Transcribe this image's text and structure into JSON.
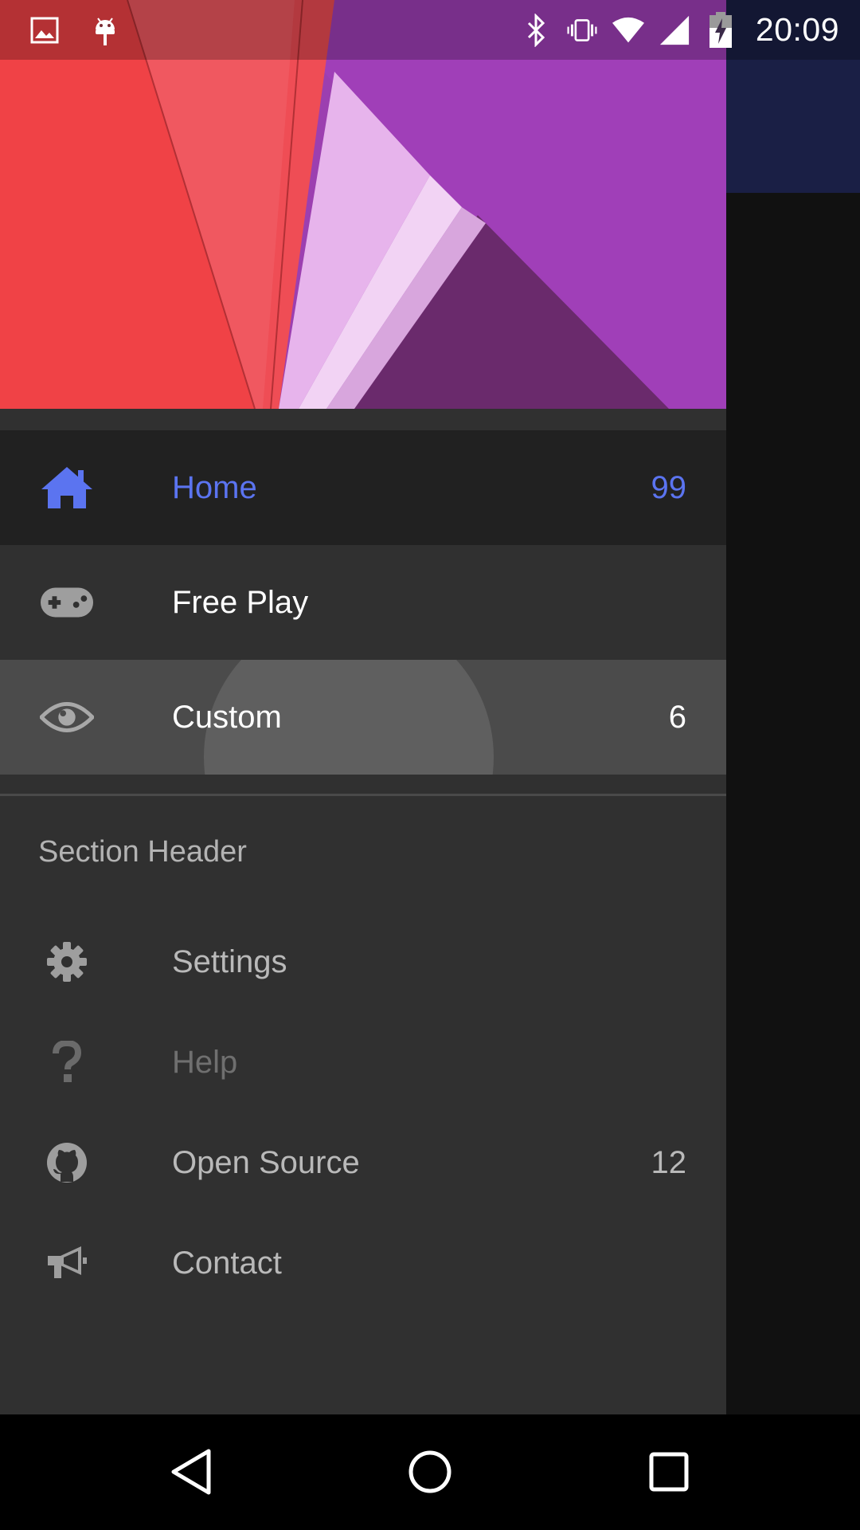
{
  "status_bar": {
    "time": "20:09",
    "left_icons": [
      "image-icon",
      "android-icon"
    ],
    "right_icons": [
      "bluetooth-icon",
      "vibrate-icon",
      "wifi-icon",
      "signal-icon",
      "battery-charging-icon"
    ]
  },
  "drawer": {
    "primary_items": [
      {
        "label": "Home",
        "badge": "99",
        "icon": "home-icon",
        "selected": true
      },
      {
        "label": "Free Play",
        "badge": "",
        "icon": "gamepad-icon"
      },
      {
        "label": "Custom",
        "badge": "6",
        "icon": "eye-icon",
        "pressed": true
      }
    ],
    "section_header": "Section Header",
    "secondary_items": [
      {
        "label": "Settings",
        "badge": "",
        "icon": "gear-icon"
      },
      {
        "label": "Help",
        "badge": "",
        "icon": "question-icon",
        "disabled": true
      },
      {
        "label": "Open Source",
        "badge": "12",
        "icon": "github-icon"
      },
      {
        "label": "Contact",
        "badge": "",
        "icon": "megaphone-icon"
      }
    ]
  },
  "nav_bar": {
    "buttons": [
      "back-icon",
      "home-circle-icon",
      "recents-icon"
    ]
  },
  "colors": {
    "accent": "#5b74f0",
    "drawer_bg": "#303030",
    "selected_bg": "#212121",
    "pressed_bg": "#4b4b4b"
  }
}
